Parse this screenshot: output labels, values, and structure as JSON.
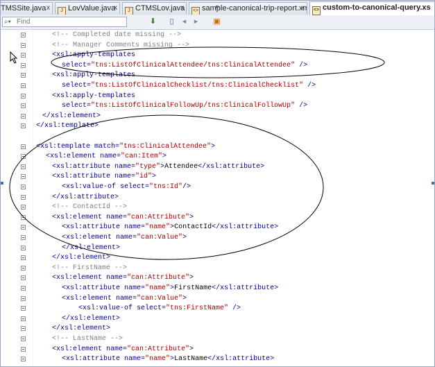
{
  "tabs": [
    {
      "label": "TMSSite.java",
      "icon": "java-file-icon"
    },
    {
      "label": "LovValue.java",
      "icon": "java-file-icon"
    },
    {
      "label": "CTMSLov.java",
      "icon": "java-file-icon"
    },
    {
      "label": "sample-canonical-trip-report.xml",
      "icon": "xml-file-icon"
    },
    {
      "label": "custom-to-canonical-query.xs",
      "icon": "xsl-file-icon"
    }
  ],
  "toolbar": {
    "find_placeholder": "Find"
  },
  "code_lines": [
    [
      {
        "t": "<!-- Completed date missing -->",
        "c": "cmt"
      }
    ],
    [
      {
        "t": "<!-- Manager Comments missing -->",
        "c": "cmt"
      }
    ],
    [
      {
        "t": "<xsl:apply-templates",
        "c": "tag"
      }
    ],
    [
      {
        "t": "select=",
        "c": "attr"
      },
      {
        "t": "\"tns:ListOfClinicalAttendee/tns:ClinicalAttendee\"",
        "c": "val"
      },
      {
        "t": " />",
        "c": "tag"
      }
    ],
    [
      {
        "t": "<xsl:apply-templates",
        "c": "tag"
      }
    ],
    [
      {
        "t": "select=",
        "c": "attr"
      },
      {
        "t": "\"tns:ListOfClinicalChecklist/tns:ClinicalChecklist\"",
        "c": "val"
      },
      {
        "t": " />",
        "c": "tag"
      }
    ],
    [
      {
        "t": "<xsl:apply-templates",
        "c": "tag"
      }
    ],
    [
      {
        "t": "select=",
        "c": "attr"
      },
      {
        "t": "\"tns:ListOfClinicalFollowUp/tns:ClinicalFollowUp\"",
        "c": "val"
      },
      {
        "t": " />",
        "c": "tag"
      }
    ],
    [
      {
        "t": "</xsl:element>",
        "c": "tag"
      }
    ],
    [
      {
        "t": "</xsl:template>",
        "c": "tag"
      }
    ],
    [],
    [
      {
        "t": "<xsl:template ",
        "c": "tag"
      },
      {
        "t": "match=",
        "c": "attr"
      },
      {
        "t": "\"tns:ClinicalAttendee\"",
        "c": "val"
      },
      {
        "t": ">",
        "c": "tag"
      }
    ],
    [
      {
        "t": "<xsl:element ",
        "c": "tag"
      },
      {
        "t": "name=",
        "c": "attr"
      },
      {
        "t": "\"can:Item\"",
        "c": "val"
      },
      {
        "t": ">",
        "c": "tag"
      }
    ],
    [
      {
        "t": "<xsl:attribute ",
        "c": "tag"
      },
      {
        "t": "name=",
        "c": "attr"
      },
      {
        "t": "\"type\"",
        "c": "val"
      },
      {
        "t": ">",
        "c": "tag"
      },
      {
        "t": "Attendee",
        "c": "txt"
      },
      {
        "t": "</xsl:attribute>",
        "c": "tag"
      }
    ],
    [
      {
        "t": "<xsl:attribute ",
        "c": "tag"
      },
      {
        "t": "name=",
        "c": "attr"
      },
      {
        "t": "\"id\"",
        "c": "val"
      },
      {
        "t": ">",
        "c": "tag"
      }
    ],
    [
      {
        "t": "<xsl:value-of ",
        "c": "tag"
      },
      {
        "t": "select=",
        "c": "attr"
      },
      {
        "t": "\"tns:Id\"",
        "c": "val"
      },
      {
        "t": "/>",
        "c": "tag"
      }
    ],
    [
      {
        "t": "</xsl:attribute>",
        "c": "tag"
      }
    ],
    [
      {
        "t": "<!-- ContactId -->",
        "c": "cmt"
      }
    ],
    [
      {
        "t": "<xsl:element ",
        "c": "tag"
      },
      {
        "t": "name=",
        "c": "attr"
      },
      {
        "t": "\"can:Attribute\"",
        "c": "val"
      },
      {
        "t": ">",
        "c": "tag"
      }
    ],
    [
      {
        "t": "<xsl:attribute ",
        "c": "tag"
      },
      {
        "t": "name=",
        "c": "attr"
      },
      {
        "t": "\"name\"",
        "c": "val"
      },
      {
        "t": ">",
        "c": "tag"
      },
      {
        "t": "ContactId",
        "c": "txt"
      },
      {
        "t": "</xsl:attribute>",
        "c": "tag"
      }
    ],
    [
      {
        "t": "<xsl:element ",
        "c": "tag"
      },
      {
        "t": "name=",
        "c": "attr"
      },
      {
        "t": "\"can:Value\"",
        "c": "val"
      },
      {
        "t": ">",
        "c": "tag"
      }
    ],
    [
      {
        "t": "</xsl:element>",
        "c": "tag"
      }
    ],
    [
      {
        "t": "</xsl:element>",
        "c": "tag"
      }
    ],
    [
      {
        "t": "<!-- FirstName -->",
        "c": "cmt"
      }
    ],
    [
      {
        "t": "<xsl:element ",
        "c": "tag"
      },
      {
        "t": "name=",
        "c": "attr"
      },
      {
        "t": "\"can:Attribute\"",
        "c": "val"
      },
      {
        "t": ">",
        "c": "tag"
      }
    ],
    [
      {
        "t": "<xsl:attribute ",
        "c": "tag"
      },
      {
        "t": "name=",
        "c": "attr"
      },
      {
        "t": "\"name\"",
        "c": "val"
      },
      {
        "t": ">",
        "c": "tag"
      },
      {
        "t": "FirstName",
        "c": "txt"
      },
      {
        "t": "</xsl:attribute>",
        "c": "tag"
      }
    ],
    [
      {
        "t": "<xsl:element ",
        "c": "tag"
      },
      {
        "t": "name=",
        "c": "attr"
      },
      {
        "t": "\"can:Value\"",
        "c": "val"
      },
      {
        "t": ">",
        "c": "tag"
      }
    ],
    [
      {
        "t": "<xsl:value-of ",
        "c": "tag"
      },
      {
        "t": "select=",
        "c": "attr"
      },
      {
        "t": "\"tns:FirstName\"",
        "c": "val"
      },
      {
        "t": " />",
        "c": "tag"
      }
    ],
    [
      {
        "t": "</xsl:element>",
        "c": "tag"
      }
    ],
    [
      {
        "t": "</xsl:element>",
        "c": "tag"
      }
    ],
    [
      {
        "t": "<!-- LastName -->",
        "c": "cmt"
      }
    ],
    [
      {
        "t": "<xsl:element ",
        "c": "tag"
      },
      {
        "t": "name=",
        "c": "attr"
      },
      {
        "t": "\"can:Attribute\"",
        "c": "val"
      },
      {
        "t": ">",
        "c": "tag"
      }
    ],
    [
      {
        "t": "<xsl:attribute ",
        "c": "tag"
      },
      {
        "t": "name=",
        "c": "attr"
      },
      {
        "t": "\"name\"",
        "c": "val"
      },
      {
        "t": ">",
        "c": "tag"
      },
      {
        "t": "LastName",
        "c": "txt"
      },
      {
        "t": "</xsl:attribute>",
        "c": "tag"
      }
    ]
  ]
}
